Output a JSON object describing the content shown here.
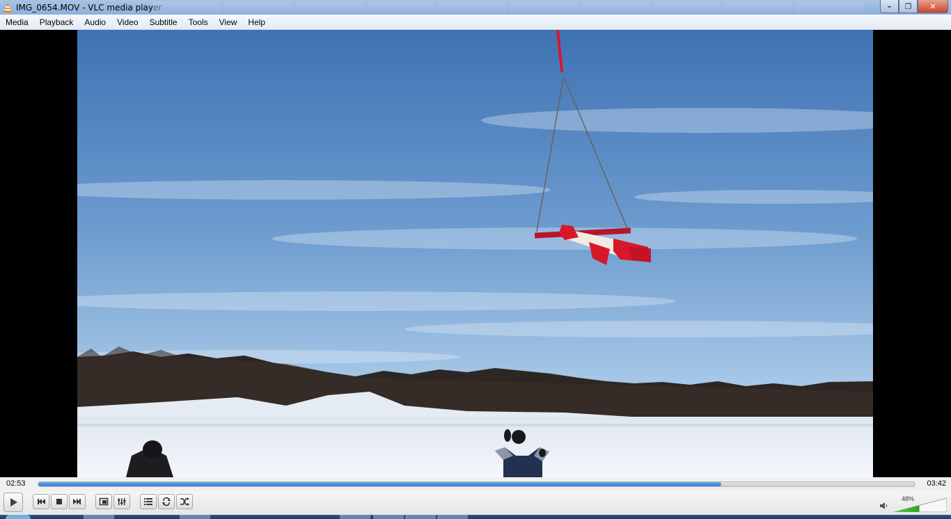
{
  "window": {
    "title": "IMG_0654.MOV - VLC media player",
    "controls": {
      "minimize": "–",
      "maximize": "❐",
      "close": "✕"
    }
  },
  "menu": {
    "items": [
      "Media",
      "Playback",
      "Audio",
      "Video",
      "Subtitle",
      "Tools",
      "View",
      "Help"
    ]
  },
  "playback": {
    "elapsed": "02:53",
    "total": "03:42",
    "progress_fraction": 0.779
  },
  "volume": {
    "percent_label": "48%",
    "level": 0.48
  },
  "colors": {
    "accent": "#2d7fd3",
    "title_bar": "#a9c3e4",
    "rocket_red": "#d8172a"
  },
  "icons": {
    "play": "play-icon",
    "previous": "previous-icon",
    "stop": "stop-icon",
    "next": "next-icon",
    "fullscreen": "fullscreen-icon",
    "extended_settings": "equalizer-icon",
    "playlist": "playlist-icon",
    "loop": "loop-icon",
    "random": "shuffle-icon",
    "speaker": "speaker-icon"
  }
}
